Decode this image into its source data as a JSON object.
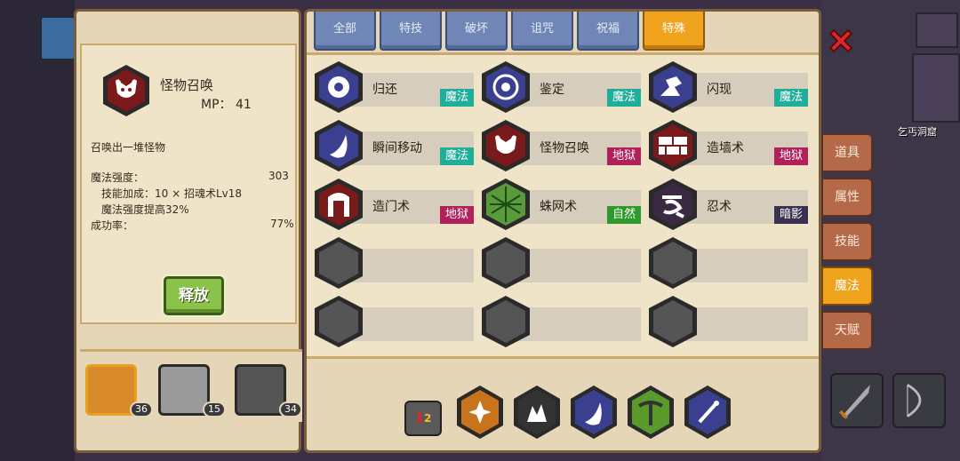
{
  "selected_spell": {
    "name": "怪物召唤",
    "mp_label": "MP：",
    "mp_value": "41",
    "description": "召唤出一堆怪物",
    "stats": {
      "power_label": "魔法强度：",
      "power_value": "303",
      "bonus_line": "技能加成：10 × 招魂术Lv18",
      "boost_line": "魔法强度提高32%",
      "success_label": "成功率：",
      "success_value": "77%"
    },
    "cast_button": "释放"
  },
  "party": [
    {
      "badge": "36",
      "color": "#d98a2a"
    },
    {
      "badge": "15",
      "color": "#9a9a9a"
    },
    {
      "badge": "34",
      "color": "#555555"
    }
  ],
  "tabs": [
    {
      "label": "全部",
      "active": false
    },
    {
      "label": "特技",
      "active": false
    },
    {
      "label": "破坏",
      "active": false
    },
    {
      "label": "诅咒",
      "active": false
    },
    {
      "label": "祝福",
      "active": false
    },
    {
      "label": "特殊",
      "active": true
    }
  ],
  "spells": [
    {
      "name": "归还",
      "tag": "魔法",
      "tag_color": "#1fae9a",
      "icon": "return-icon",
      "hex_color": "#3b3f8f"
    },
    {
      "name": "鉴定",
      "tag": "魔法",
      "tag_color": "#1fae9a",
      "icon": "identify-icon",
      "hex_color": "#3b3f8f"
    },
    {
      "name": "闪现",
      "tag": "魔法",
      "tag_color": "#1fae9a",
      "icon": "blink-icon",
      "hex_color": "#3b3f8f"
    },
    {
      "name": "瞬间移动",
      "tag": "魔法",
      "tag_color": "#1fae9a",
      "icon": "teleport-icon",
      "hex_color": "#3b3f8f"
    },
    {
      "name": "怪物召唤",
      "tag": "地狱",
      "tag_color": "#b0205a",
      "icon": "summon-monster-icon",
      "hex_color": "#7a1a1a"
    },
    {
      "name": "造墙术",
      "tag": "地狱",
      "tag_color": "#b0205a",
      "icon": "wall-icon",
      "hex_color": "#7a1a1a"
    },
    {
      "name": "造门术",
      "tag": "地狱",
      "tag_color": "#b0205a",
      "icon": "door-icon",
      "hex_color": "#7a1a1a"
    },
    {
      "name": "蛛网术",
      "tag": "自然",
      "tag_color": "#2e9a2e",
      "icon": "web-icon",
      "hex_color": "#2f6a2a"
    },
    {
      "name": "忍术",
      "tag": "暗影",
      "tag_color": "#3a3050",
      "icon": "ninja-icon",
      "hex_color": "#3a2a44"
    }
  ],
  "page_button": {
    "top": "1",
    "bottom": "2"
  },
  "quick_slots": [
    {
      "icon": "shuriken-icon",
      "color": "#c8741c"
    },
    {
      "icon": "shadow-burst-icon",
      "color": "#333333"
    },
    {
      "icon": "wind-blade-icon",
      "color": "#3b3f8f"
    },
    {
      "icon": "pickaxe-icon",
      "color": "#5a9a2a"
    },
    {
      "icon": "magic-wand-icon",
      "color": "#3b3f8f"
    }
  ],
  "side_tabs": [
    {
      "label": "道具",
      "active": false
    },
    {
      "label": "属性",
      "active": false
    },
    {
      "label": "技能",
      "active": false
    },
    {
      "label": "魔法",
      "active": true
    },
    {
      "label": "天赋",
      "active": false
    }
  ],
  "location_label": "乞丐洞窟"
}
